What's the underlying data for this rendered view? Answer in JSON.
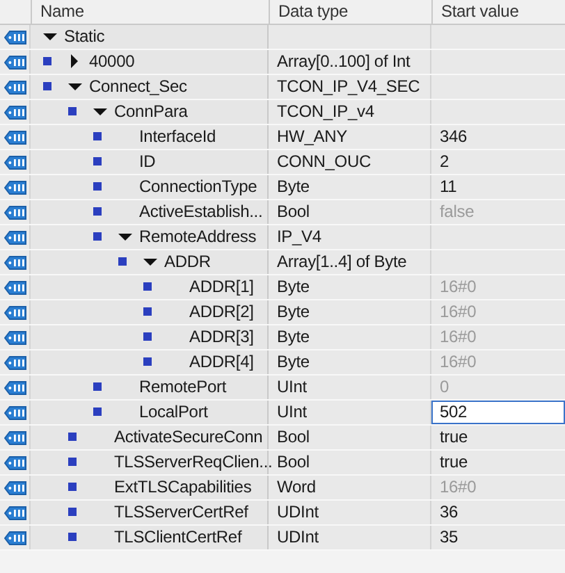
{
  "columns": [
    "Name",
    "Data type",
    "Start value"
  ],
  "rows": [
    {
      "name": "Static",
      "expanded": true,
      "selected": false,
      "children": [
        {
          "name": "40000",
          "type": "Array[0..100] of Int",
          "expanded": false,
          "selected": false
        },
        {
          "name": "Connect_Sec",
          "type": "TCON_IP_V4_SEC",
          "expanded": true,
          "selected": false,
          "children": [
            {
              "name": "ConnPara",
              "type": "TCON_IP_v4",
              "expanded": true,
              "selected": false,
              "children": [
                {
                  "name": "InterfaceId",
                  "type": "HW_ANY",
                  "value": "346",
                  "dimmed": false,
                  "selected": false
                },
                {
                  "name": "ID",
                  "type": "CONN_OUC",
                  "value": "2",
                  "dimmed": false,
                  "selected": false
                },
                {
                  "name": "ConnectionType",
                  "type": "Byte",
                  "value": "11",
                  "dimmed": false,
                  "selected": false
                },
                {
                  "name": "ActiveEstablish...",
                  "type": "Bool",
                  "value": "false",
                  "dimmed": true,
                  "selected": false
                },
                {
                  "name": "RemoteAddress",
                  "type": "IP_V4",
                  "expanded": true,
                  "selected": false,
                  "children": [
                    {
                      "name": "ADDR",
                      "type": "Array[1..4] of Byte",
                      "expanded": true,
                      "selected": false,
                      "children": [
                        {
                          "name": "ADDR[1]",
                          "type": "Byte",
                          "value": "16#0",
                          "dimmed": true,
                          "selected": false
                        },
                        {
                          "name": "ADDR[2]",
                          "type": "Byte",
                          "value": "16#0",
                          "dimmed": true,
                          "selected": false
                        },
                        {
                          "name": "ADDR[3]",
                          "type": "Byte",
                          "value": "16#0",
                          "dimmed": true,
                          "selected": false
                        },
                        {
                          "name": "ADDR[4]",
                          "type": "Byte",
                          "value": "16#0",
                          "dimmed": true,
                          "selected": false
                        }
                      ]
                    }
                  ]
                },
                {
                  "name": "RemotePort",
                  "type": "UInt",
                  "value": "0",
                  "dimmed": true,
                  "selected": false
                },
                {
                  "name": "LocalPort",
                  "type": "UInt",
                  "value": "502",
                  "dimmed": false,
                  "selected": true
                }
              ]
            },
            {
              "name": "ActivateSecureConn",
              "type": "Bool",
              "value": "true",
              "dimmed": false,
              "selected": false
            },
            {
              "name": "TLSServerReqClien...",
              "type": "Bool",
              "value": "true",
              "dimmed": false,
              "selected": false
            },
            {
              "name": "ExtTLSCapabilities",
              "type": "Word",
              "value": "16#0",
              "dimmed": true,
              "selected": false
            },
            {
              "name": "TLSServerCertRef",
              "type": "UDInt",
              "value": "36",
              "dimmed": false,
              "selected": false
            },
            {
              "name": "TLSClientCertRef",
              "type": "UDInt",
              "value": "35",
              "dimmed": false,
              "selected": false
            }
          ]
        }
      ]
    }
  ]
}
